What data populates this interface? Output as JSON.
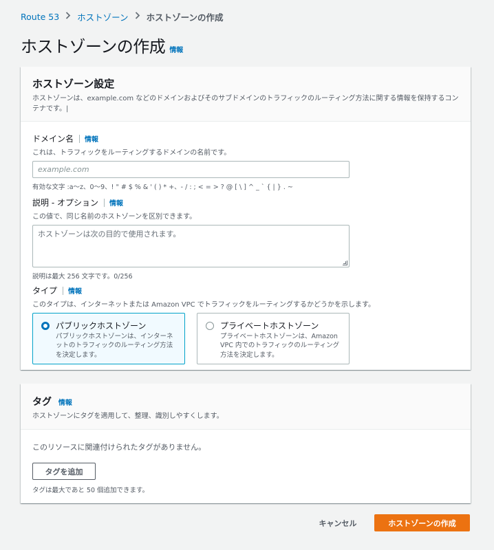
{
  "breadcrumb": {
    "items": [
      "Route 53",
      "ホストゾーン"
    ],
    "current": "ホストゾーンの作成",
    "separator_icon": "chevron-right"
  },
  "page": {
    "title": "ホストゾーンの作成",
    "info": "情報"
  },
  "settings": {
    "title": "ホストゾーン設定",
    "description": "ホストゾーンは、example.com などのドメインおよびそのサブドメインのトラフィックのルーティング方法に関する情報を保持するコンテナです。|",
    "domain": {
      "label": "ドメイン名",
      "info": "情報",
      "description": "これは、トラフィックをルーティングするドメインの名前です。",
      "placeholder": "example.com",
      "value": "",
      "constraint": "有効な文字 :a〜z、0〜9、! \" # $ % & ' ( ) * +、- / : ; < = > ? @ [ \\ ] ^ _ ` { | } . ~"
    },
    "comment": {
      "label": "説明 - オプション",
      "info": "情報",
      "description": "この値で、同じ名前のホストゾーンを区別できます。",
      "placeholder": "ホストゾーンは次の目的で使用されます。",
      "constraint": "説明は最大 256 文字です。0/256"
    },
    "type": {
      "label": "タイプ",
      "info": "情報",
      "description": "このタイプは、インターネットまたは Amazon VPC でトラフィックをルーティングするかどうかを示します。",
      "options": [
        {
          "title": "パブリックホストゾーン",
          "description": "パブリックホストゾーンは、インターネットのトラフィックのルーティング方法を決定します。",
          "selected": true
        },
        {
          "title": "プライベートホストゾーン",
          "description": "プライベートホストゾーンは、Amazon VPC 内でのトラフィックのルーティング方法を決定します。",
          "selected": false
        }
      ]
    }
  },
  "tags": {
    "title": "タグ",
    "info": "情報",
    "description": "ホストゾーンにタグを適用して、整理、識別しやすくします。",
    "empty": "このリソースに関連付けられたタグがありません。",
    "add_button": "タグを追加",
    "limit": "タグは最大であと 50 個追加できます。"
  },
  "footer": {
    "cancel": "キャンセル",
    "submit": "ホストゾーンの作成"
  },
  "colors": {
    "link": "#0073bb",
    "primary": "#ec7211",
    "selected_border": "#00a1c9",
    "selected_bg": "#f1faff"
  }
}
